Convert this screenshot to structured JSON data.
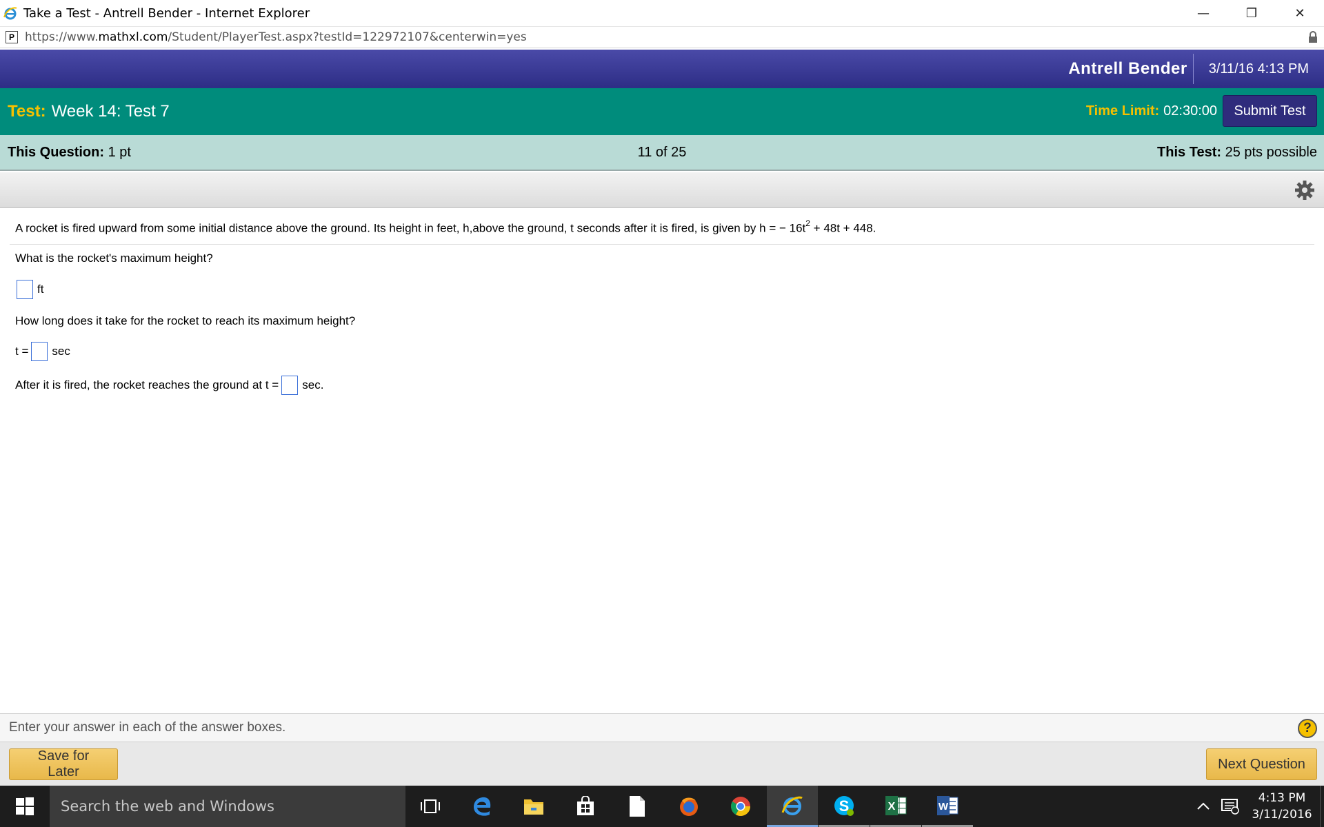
{
  "window": {
    "title": "Take a Test - Antrell Bender - Internet Explorer",
    "minimize_glyph": "—",
    "restore_glyph": "❐",
    "close_glyph": "✕"
  },
  "address": {
    "favicon_letter": "P",
    "url_scheme": "https://www.",
    "url_host": "mathxl.com",
    "url_path": "/Student/PlayerTest.aspx?testId=122972107&centerwin=yes"
  },
  "header": {
    "user_name": "Antrell Bender",
    "datetime": "3/11/16 4:13 PM"
  },
  "test": {
    "label": "Test:",
    "name": "Week 14: Test 7",
    "time_limit_label": "Time Limit:",
    "time_limit_value": "02:30:00",
    "submit_label": "Submit Test"
  },
  "question_info": {
    "this_question_label": "This Question:",
    "this_question_value": "1 pt",
    "progress": "11 of 25",
    "this_test_label": "This Test:",
    "this_test_value": "25 pts possible"
  },
  "question": {
    "stem_prefix": "A rocket is fired upward from some initial distance above the ground. Its height in feet, h,above the ground, t seconds after it is fired, is given by h = − 16t",
    "stem_exponent": "2",
    "stem_suffix": " + 48t + 448.",
    "part1_prompt": "What is the rocket's maximum height?",
    "part1_unit": "ft",
    "part2_prompt": "How long does it take for the rocket to reach its maximum height?",
    "part2_prefix": "t =",
    "part2_unit": "sec",
    "part3_prefix": "After it is fired, the rocket reaches the ground at t =",
    "part3_unit": "sec."
  },
  "footer": {
    "instruction": "Enter your answer in each of the answer boxes.",
    "help_glyph": "?",
    "save_label": "Save for Later",
    "next_label": "Next Question"
  },
  "taskbar": {
    "search_placeholder": "Search the web and Windows",
    "clock_time": "4:13 PM",
    "clock_date": "3/11/2016"
  },
  "colors": {
    "user_bar": "#2d2d85",
    "test_bar": "#008c7c",
    "accent_yellow": "#f5c000",
    "question_bar": "#b9dbd6",
    "submit_button": "#2f2c7c"
  },
  "icons": [
    "ie-icon",
    "lock-icon",
    "gear-icon",
    "help-icon",
    "windows-start-icon",
    "task-view-icon",
    "edge-icon",
    "file-explorer-icon",
    "store-icon",
    "document-icon",
    "firefox-icon",
    "chrome-icon",
    "skype-icon",
    "excel-icon",
    "word-icon",
    "chevron-up-icon",
    "notifications-icon"
  ]
}
